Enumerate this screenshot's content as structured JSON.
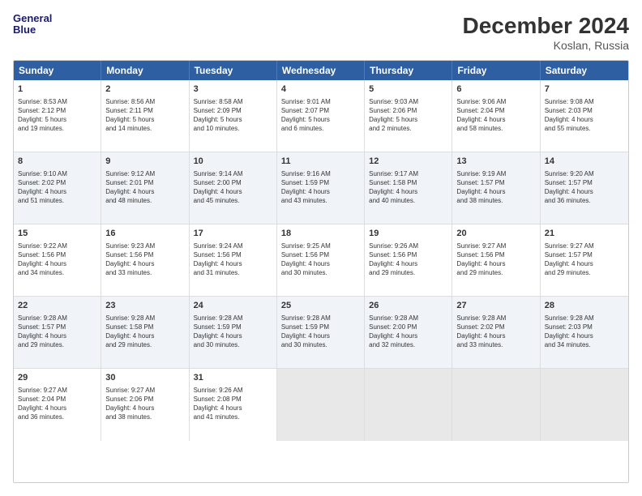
{
  "header": {
    "logo_line1": "General",
    "logo_line2": "Blue",
    "title": "December 2024",
    "subtitle": "Koslan, Russia"
  },
  "weekdays": [
    "Sunday",
    "Monday",
    "Tuesday",
    "Wednesday",
    "Thursday",
    "Friday",
    "Saturday"
  ],
  "weeks": [
    [
      {
        "day": "1",
        "lines": [
          "Sunrise: 8:53 AM",
          "Sunset: 2:12 PM",
          "Daylight: 5 hours",
          "and 19 minutes."
        ]
      },
      {
        "day": "2",
        "lines": [
          "Sunrise: 8:56 AM",
          "Sunset: 2:11 PM",
          "Daylight: 5 hours",
          "and 14 minutes."
        ]
      },
      {
        "day": "3",
        "lines": [
          "Sunrise: 8:58 AM",
          "Sunset: 2:09 PM",
          "Daylight: 5 hours",
          "and 10 minutes."
        ]
      },
      {
        "day": "4",
        "lines": [
          "Sunrise: 9:01 AM",
          "Sunset: 2:07 PM",
          "Daylight: 5 hours",
          "and 6 minutes."
        ]
      },
      {
        "day": "5",
        "lines": [
          "Sunrise: 9:03 AM",
          "Sunset: 2:06 PM",
          "Daylight: 5 hours",
          "and 2 minutes."
        ]
      },
      {
        "day": "6",
        "lines": [
          "Sunrise: 9:06 AM",
          "Sunset: 2:04 PM",
          "Daylight: 4 hours",
          "and 58 minutes."
        ]
      },
      {
        "day": "7",
        "lines": [
          "Sunrise: 9:08 AM",
          "Sunset: 2:03 PM",
          "Daylight: 4 hours",
          "and 55 minutes."
        ]
      }
    ],
    [
      {
        "day": "8",
        "lines": [
          "Sunrise: 9:10 AM",
          "Sunset: 2:02 PM",
          "Daylight: 4 hours",
          "and 51 minutes."
        ]
      },
      {
        "day": "9",
        "lines": [
          "Sunrise: 9:12 AM",
          "Sunset: 2:01 PM",
          "Daylight: 4 hours",
          "and 48 minutes."
        ]
      },
      {
        "day": "10",
        "lines": [
          "Sunrise: 9:14 AM",
          "Sunset: 2:00 PM",
          "Daylight: 4 hours",
          "and 45 minutes."
        ]
      },
      {
        "day": "11",
        "lines": [
          "Sunrise: 9:16 AM",
          "Sunset: 1:59 PM",
          "Daylight: 4 hours",
          "and 43 minutes."
        ]
      },
      {
        "day": "12",
        "lines": [
          "Sunrise: 9:17 AM",
          "Sunset: 1:58 PM",
          "Daylight: 4 hours",
          "and 40 minutes."
        ]
      },
      {
        "day": "13",
        "lines": [
          "Sunrise: 9:19 AM",
          "Sunset: 1:57 PM",
          "Daylight: 4 hours",
          "and 38 minutes."
        ]
      },
      {
        "day": "14",
        "lines": [
          "Sunrise: 9:20 AM",
          "Sunset: 1:57 PM",
          "Daylight: 4 hours",
          "and 36 minutes."
        ]
      }
    ],
    [
      {
        "day": "15",
        "lines": [
          "Sunrise: 9:22 AM",
          "Sunset: 1:56 PM",
          "Daylight: 4 hours",
          "and 34 minutes."
        ]
      },
      {
        "day": "16",
        "lines": [
          "Sunrise: 9:23 AM",
          "Sunset: 1:56 PM",
          "Daylight: 4 hours",
          "and 33 minutes."
        ]
      },
      {
        "day": "17",
        "lines": [
          "Sunrise: 9:24 AM",
          "Sunset: 1:56 PM",
          "Daylight: 4 hours",
          "and 31 minutes."
        ]
      },
      {
        "day": "18",
        "lines": [
          "Sunrise: 9:25 AM",
          "Sunset: 1:56 PM",
          "Daylight: 4 hours",
          "and 30 minutes."
        ]
      },
      {
        "day": "19",
        "lines": [
          "Sunrise: 9:26 AM",
          "Sunset: 1:56 PM",
          "Daylight: 4 hours",
          "and 29 minutes."
        ]
      },
      {
        "day": "20",
        "lines": [
          "Sunrise: 9:27 AM",
          "Sunset: 1:56 PM",
          "Daylight: 4 hours",
          "and 29 minutes."
        ]
      },
      {
        "day": "21",
        "lines": [
          "Sunrise: 9:27 AM",
          "Sunset: 1:57 PM",
          "Daylight: 4 hours",
          "and 29 minutes."
        ]
      }
    ],
    [
      {
        "day": "22",
        "lines": [
          "Sunrise: 9:28 AM",
          "Sunset: 1:57 PM",
          "Daylight: 4 hours",
          "and 29 minutes."
        ]
      },
      {
        "day": "23",
        "lines": [
          "Sunrise: 9:28 AM",
          "Sunset: 1:58 PM",
          "Daylight: 4 hours",
          "and 29 minutes."
        ]
      },
      {
        "day": "24",
        "lines": [
          "Sunrise: 9:28 AM",
          "Sunset: 1:59 PM",
          "Daylight: 4 hours",
          "and 30 minutes."
        ]
      },
      {
        "day": "25",
        "lines": [
          "Sunrise: 9:28 AM",
          "Sunset: 1:59 PM",
          "Daylight: 4 hours",
          "and 30 minutes."
        ]
      },
      {
        "day": "26",
        "lines": [
          "Sunrise: 9:28 AM",
          "Sunset: 2:00 PM",
          "Daylight: 4 hours",
          "and 32 minutes."
        ]
      },
      {
        "day": "27",
        "lines": [
          "Sunrise: 9:28 AM",
          "Sunset: 2:02 PM",
          "Daylight: 4 hours",
          "and 33 minutes."
        ]
      },
      {
        "day": "28",
        "lines": [
          "Sunrise: 9:28 AM",
          "Sunset: 2:03 PM",
          "Daylight: 4 hours",
          "and 34 minutes."
        ]
      }
    ],
    [
      {
        "day": "29",
        "lines": [
          "Sunrise: 9:27 AM",
          "Sunset: 2:04 PM",
          "Daylight: 4 hours",
          "and 36 minutes."
        ]
      },
      {
        "day": "30",
        "lines": [
          "Sunrise: 9:27 AM",
          "Sunset: 2:06 PM",
          "Daylight: 4 hours",
          "and 38 minutes."
        ]
      },
      {
        "day": "31",
        "lines": [
          "Sunrise: 9:26 AM",
          "Sunset: 2:08 PM",
          "Daylight: 4 hours",
          "and 41 minutes."
        ]
      },
      {
        "day": "",
        "lines": []
      },
      {
        "day": "",
        "lines": []
      },
      {
        "day": "",
        "lines": []
      },
      {
        "day": "",
        "lines": []
      }
    ]
  ]
}
